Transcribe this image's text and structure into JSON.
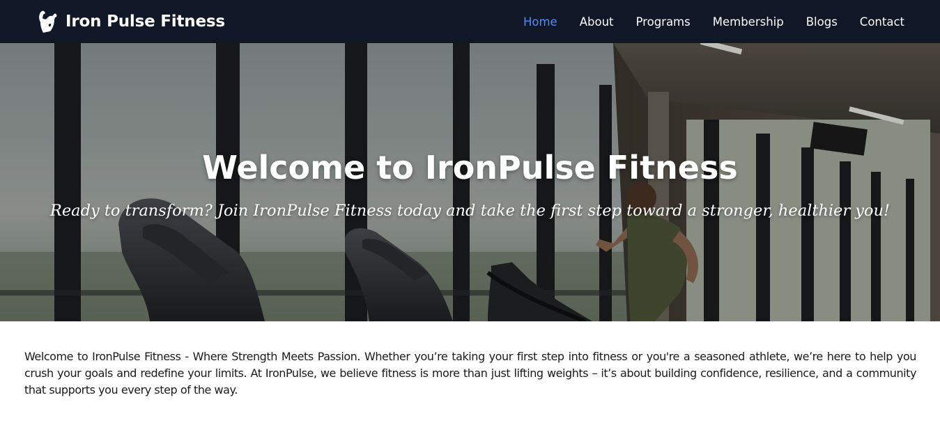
{
  "header": {
    "brand_name": "Iron Pulse Fitness",
    "brand_icon": "flexing-muscle-icon",
    "nav": [
      {
        "label": "Home",
        "active": true
      },
      {
        "label": "About",
        "active": false
      },
      {
        "label": "Programs",
        "active": false
      },
      {
        "label": "Membership",
        "active": false
      },
      {
        "label": "Blogs",
        "active": false
      },
      {
        "label": "Contact",
        "active": false
      }
    ],
    "colors": {
      "background": "#101828",
      "active_link": "#4d8dfd",
      "link": "#ffffff"
    }
  },
  "hero": {
    "title": "Welcome to IronPulse Fitness",
    "subtitle": "Ready to transform? Join IronPulse Fitness today and take the first step toward a stronger, healthier you!"
  },
  "intro": {
    "text": "Welcome to IronPulse Fitness - Where Strength Meets Passion. Whether you’re taking your first step into fitness or you're a seasoned athlete, we’re here to help you crush your goals and redefine your limits. At IronPulse, we believe fitness is more than just lifting weights – it’s about building confidence, resilience, and a community that supports you every step of the way."
  }
}
